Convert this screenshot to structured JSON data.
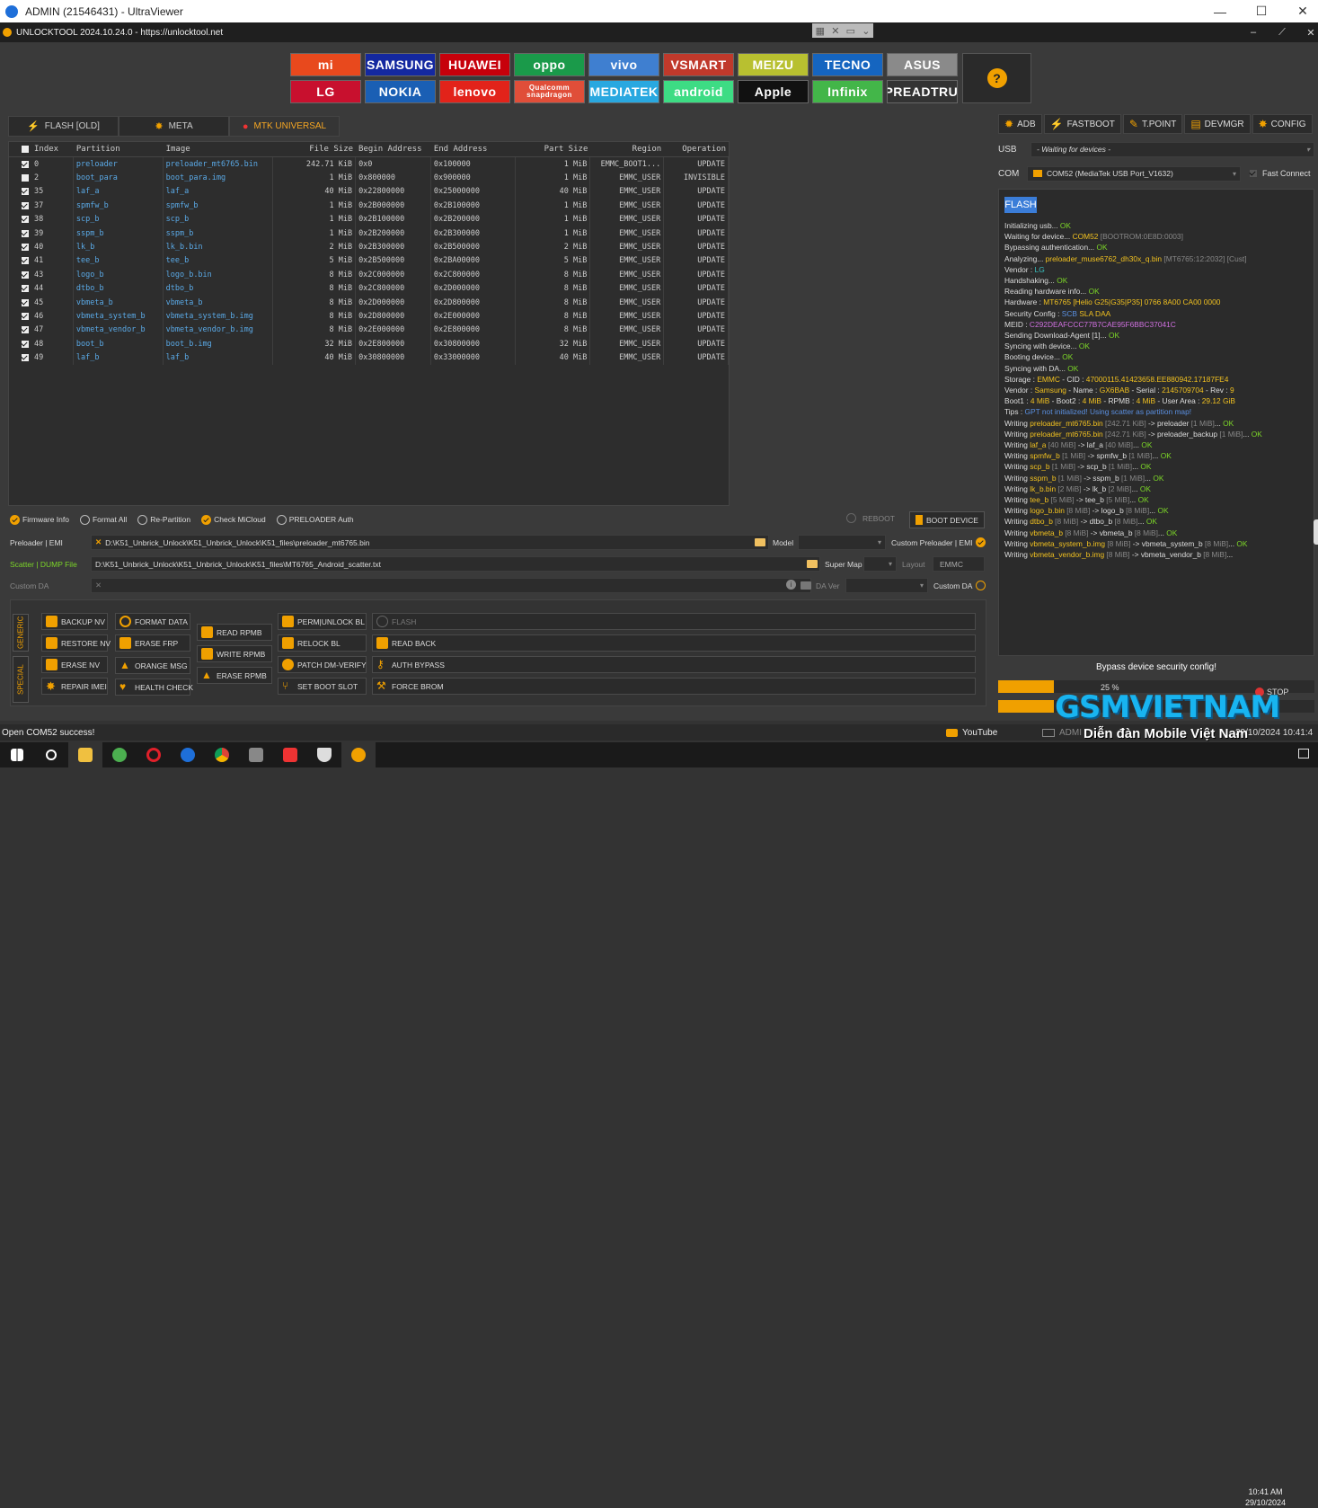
{
  "uv": {
    "title": "ADMIN (21546431) - UltraViewer"
  },
  "app": {
    "title": "UNLOCKTOOL 2024.10.24.0 - https://unlocktool.net"
  },
  "brands": [
    {
      "name": "mi",
      "bg": "#e8491d"
    },
    {
      "name": "SAMSUNG",
      "bg": "#1428a0"
    },
    {
      "name": "HUAWEI",
      "bg": "#c7000b"
    },
    {
      "name": "oppo",
      "bg": "#1a9a4a"
    },
    {
      "name": "vivo",
      "bg": "#3f7fd0"
    },
    {
      "name": "VSMART",
      "bg": "#c0392b"
    },
    {
      "name": "MEIZU",
      "bg": "#b8c030"
    },
    {
      "name": "TECNO",
      "bg": "#1565c0"
    },
    {
      "name": "ASUS",
      "bg": "#8a8a8a"
    },
    {
      "name": "LG",
      "bg": "#c8102e"
    },
    {
      "name": "NOKIA",
      "bg": "#1a5fb4"
    },
    {
      "name": "lenovo",
      "bg": "#e2231a"
    },
    {
      "name": "Qualcomm snapdragon",
      "bg": "#e04e39"
    },
    {
      "name": "MEDIATEK",
      "bg": "#29a8e0"
    },
    {
      "name": "android",
      "bg": "#3ddc84"
    },
    {
      "name": "Apple",
      "bg": "#111111"
    },
    {
      "name": "Infinix",
      "bg": "#43b649"
    },
    {
      "name": "SPREADTRUM",
      "bg": "#333333"
    }
  ],
  "help": {
    "icon": "question-icon",
    "glyph": "?"
  },
  "tabs": [
    {
      "label": "FLASH [OLD]",
      "glyph": "⚡"
    },
    {
      "label": "META",
      "glyph": "✸"
    },
    {
      "label": "MTK UNIVERSAL",
      "glyph": "●"
    }
  ],
  "grid": {
    "headers": [
      "Index",
      "Partition",
      "Image",
      "File Size",
      "Begin Address",
      "End Address",
      "Part Size",
      "Region",
      "Operation"
    ],
    "rows": [
      {
        "idx": "0",
        "part": "preloader",
        "img": "preloader_mt6765.bin",
        "fs": "242.71 KiB",
        "ba": "0x0",
        "ea": "0x100000",
        "ps": "1 MiB",
        "reg": "EMMC_BOOT1...",
        "op": "UPDATE",
        "checked": true
      },
      {
        "idx": "2",
        "part": "boot_para",
        "img": "boot_para.img",
        "fs": "1 MiB",
        "ba": "0x800000",
        "ea": "0x900000",
        "ps": "1 MiB",
        "reg": "EMMC_USER",
        "op": "INVISIBLE",
        "checked": false
      },
      {
        "idx": "35",
        "part": "laf_a",
        "img": "laf_a",
        "fs": "40 MiB",
        "ba": "0x22800000",
        "ea": "0x25000000",
        "ps": "40 MiB",
        "reg": "EMMC_USER",
        "op": "UPDATE",
        "checked": true
      },
      {
        "idx": "37",
        "part": "spmfw_b",
        "img": "spmfw_b",
        "fs": "1 MiB",
        "ba": "0x2B000000",
        "ea": "0x2B100000",
        "ps": "1 MiB",
        "reg": "EMMC_USER",
        "op": "UPDATE",
        "checked": true
      },
      {
        "idx": "38",
        "part": "scp_b",
        "img": "scp_b",
        "fs": "1 MiB",
        "ba": "0x2B100000",
        "ea": "0x2B200000",
        "ps": "1 MiB",
        "reg": "EMMC_USER",
        "op": "UPDATE",
        "checked": true
      },
      {
        "idx": "39",
        "part": "sspm_b",
        "img": "sspm_b",
        "fs": "1 MiB",
        "ba": "0x2B200000",
        "ea": "0x2B300000",
        "ps": "1 MiB",
        "reg": "EMMC_USER",
        "op": "UPDATE",
        "checked": true
      },
      {
        "idx": "40",
        "part": "lk_b",
        "img": "lk_b.bin",
        "fs": "2 MiB",
        "ba": "0x2B300000",
        "ea": "0x2B500000",
        "ps": "2 MiB",
        "reg": "EMMC_USER",
        "op": "UPDATE",
        "checked": true
      },
      {
        "idx": "41",
        "part": "tee_b",
        "img": "tee_b",
        "fs": "5 MiB",
        "ba": "0x2B500000",
        "ea": "0x2BA00000",
        "ps": "5 MiB",
        "reg": "EMMC_USER",
        "op": "UPDATE",
        "checked": true
      },
      {
        "idx": "43",
        "part": "logo_b",
        "img": "logo_b.bin",
        "fs": "8 MiB",
        "ba": "0x2C000000",
        "ea": "0x2C800000",
        "ps": "8 MiB",
        "reg": "EMMC_USER",
        "op": "UPDATE",
        "checked": true
      },
      {
        "idx": "44",
        "part": "dtbo_b",
        "img": "dtbo_b",
        "fs": "8 MiB",
        "ba": "0x2C800000",
        "ea": "0x2D000000",
        "ps": "8 MiB",
        "reg": "EMMC_USER",
        "op": "UPDATE",
        "checked": true
      },
      {
        "idx": "45",
        "part": "vbmeta_b",
        "img": "vbmeta_b",
        "fs": "8 MiB",
        "ba": "0x2D000000",
        "ea": "0x2D800000",
        "ps": "8 MiB",
        "reg": "EMMC_USER",
        "op": "UPDATE",
        "checked": true
      },
      {
        "idx": "46",
        "part": "vbmeta_system_b",
        "img": "vbmeta_system_b.img",
        "fs": "8 MiB",
        "ba": "0x2D800000",
        "ea": "0x2E000000",
        "ps": "8 MiB",
        "reg": "EMMC_USER",
        "op": "UPDATE",
        "checked": true
      },
      {
        "idx": "47",
        "part": "vbmeta_vendor_b",
        "img": "vbmeta_vendor_b.img",
        "fs": "8 MiB",
        "ba": "0x2E000000",
        "ea": "0x2E800000",
        "ps": "8 MiB",
        "reg": "EMMC_USER",
        "op": "UPDATE",
        "checked": true
      },
      {
        "idx": "48",
        "part": "boot_b",
        "img": "boot_b.img",
        "fs": "32 MiB",
        "ba": "0x2E800000",
        "ea": "0x30800000",
        "ps": "32 MiB",
        "reg": "EMMC_USER",
        "op": "UPDATE",
        "checked": true
      },
      {
        "idx": "49",
        "part": "laf_b",
        "img": "laf_b",
        "fs": "40 MiB",
        "ba": "0x30800000",
        "ea": "0x33000000",
        "ps": "40 MiB",
        "reg": "EMMC_USER",
        "op": "UPDATE",
        "checked": true
      }
    ]
  },
  "options": [
    {
      "label": "Firmware Info",
      "checked": true
    },
    {
      "label": "Format All",
      "checked": false
    },
    {
      "label": "Re-Partition",
      "checked": false
    },
    {
      "label": "Check MiCloud",
      "checked": true
    },
    {
      "label": "PRELOADER Auth",
      "checked": false
    }
  ],
  "reboot": "REBOOT",
  "boot_device": "BOOT DEVICE",
  "preloader": {
    "label": "Preloader | EMI",
    "path": "D:\\K51_Unbrick_Unlock\\K51_Unbrick_Unlock\\K51_files\\preloader_mt6765.bin"
  },
  "model_label": "Model",
  "custom_preloader": "Custom Preloader | EMI",
  "scatter": {
    "label": "Scatter | DUMP File",
    "path": "D:\\K51_Unbrick_Unlock\\K51_Unbrick_Unlock\\K51_files\\MT6765_Android_scatter.txt"
  },
  "super_map": "Super Map",
  "layout_label": "Layout",
  "layout_value": "EMMC",
  "custom_da": {
    "label": "Custom DA",
    "right": "Custom DA",
    "da_ver": "DA Ver"
  },
  "vtabs": {
    "generic": "GENERIC",
    "special": "SPECIAL"
  },
  "buttons": {
    "backup_nv": "BACKUP NV",
    "restore_nv": "RESTORE NV",
    "erase_nv": "ERASE NV",
    "repair_imei": "REPAIR IMEI",
    "format_data": "FORMAT DATA",
    "erase_frp": "ERASE FRP",
    "orange_msg": "ORANGE MSG",
    "health_check": "HEALTH CHECK",
    "read_rpmb": "READ RPMB",
    "write_rpmb": "WRITE RPMB",
    "erase_rpmb": "ERASE RPMB",
    "perm_unlock": "PERM|UNLOCK BL",
    "relock": "RELOCK BL",
    "patch_dm": "PATCH DM-VERIFY",
    "set_boot": "SET BOOT SLOT",
    "flash": "FLASH",
    "read_back": "READ BACK",
    "auth_bypass": "AUTH BYPASS",
    "force_brom": "FORCE BROM"
  },
  "rtabs": [
    {
      "label": "ADB",
      "glyph": "✹"
    },
    {
      "label": "FASTBOOT",
      "glyph": "⚡"
    },
    {
      "label": "T.POINT",
      "glyph": "✎"
    },
    {
      "label": "DEVMGR",
      "glyph": "▤"
    },
    {
      "label": "CONFIG",
      "glyph": "✸"
    }
  ],
  "usb": {
    "label": "USB",
    "value": "- Waiting for devices -"
  },
  "com": {
    "label": "COM",
    "value": "COM52 (MediaTek USB Port_V1632)",
    "fast_connect": "Fast Connect"
  },
  "flash_badge": "FLASH",
  "log": [
    [
      [
        "Initializing usb... ",
        ""
      ],
      [
        "OK",
        "ok"
      ]
    ],
    [
      [
        "Waiting for device... ",
        ""
      ],
      [
        "COM52",
        "y"
      ],
      [
        " [BOOTROM:0E8D:0003]",
        "g"
      ]
    ],
    [
      [
        "Bypassing authentication... ",
        ""
      ],
      [
        "OK",
        "ok"
      ]
    ],
    [
      [
        "Analyzing... ",
        ""
      ],
      [
        "preloader_muse6762_dh30x_q.bin",
        "y"
      ],
      [
        " [MT6765:12:2032] [Cust]",
        "g"
      ]
    ],
    [
      [
        "Vendor : ",
        ""
      ],
      [
        "LG",
        "cy"
      ]
    ],
    [
      [
        "Handshaking... ",
        ""
      ],
      [
        "OK",
        "ok"
      ]
    ],
    [
      [
        "Reading hardware info... ",
        ""
      ],
      [
        "OK",
        "ok"
      ]
    ],
    [
      [
        "  Hardware : ",
        ""
      ],
      [
        "MT6765 [Helio G25|G35|P35] 0766 8A00 CA00 0000",
        "y"
      ]
    ],
    [
      [
        "  Security Config : ",
        ""
      ],
      [
        "SCB ",
        "bl"
      ],
      [
        "SLA DAA",
        "y"
      ]
    ],
    [
      [
        "  MEID : ",
        ""
      ],
      [
        "C292DEAFCCC77B7CAE95F6BBC37041C",
        "pk"
      ]
    ],
    [
      [
        "Sending Download-Agent [1]... ",
        ""
      ],
      [
        "OK",
        "ok"
      ]
    ],
    [
      [
        "Syncing with device... ",
        ""
      ],
      [
        "OK",
        "ok"
      ]
    ],
    [
      [
        "Booting device... ",
        ""
      ],
      [
        "OK",
        "ok"
      ]
    ],
    [
      [
        "Syncing with DA... ",
        ""
      ],
      [
        "OK",
        "ok"
      ]
    ],
    [
      [
        "  Storage : ",
        ""
      ],
      [
        "EMMC",
        "y"
      ],
      [
        " - CID : ",
        ""
      ],
      [
        "47000115.41423658.EE880942.17187FE4",
        "y"
      ]
    ],
    [
      [
        "  Vendor : ",
        ""
      ],
      [
        "Samsung",
        "y"
      ],
      [
        " - Name : ",
        ""
      ],
      [
        "GX6BAB",
        "y"
      ],
      [
        " - Serial : ",
        ""
      ],
      [
        "2145709704",
        "y"
      ],
      [
        " - Rev : ",
        ""
      ],
      [
        "9",
        "y"
      ]
    ],
    [
      [
        "  Boot1 : ",
        ""
      ],
      [
        "4 MiB",
        "y"
      ],
      [
        " - Boot2 : ",
        ""
      ],
      [
        "4 MiB",
        "y"
      ],
      [
        " - RPMB : ",
        ""
      ],
      [
        "4 MiB",
        "y"
      ],
      [
        " - User Area : ",
        ""
      ],
      [
        "29.12 GiB",
        "y"
      ]
    ],
    [
      [
        "Tips : ",
        ""
      ],
      [
        "GPT not initialized! Using scatter as partition map!",
        "lg"
      ]
    ],
    [
      [
        "Writing ",
        ""
      ],
      [
        "preloader_mt6765.bin",
        "y"
      ],
      [
        " [242.71 KiB]",
        "g"
      ],
      [
        " -> preloader ",
        ""
      ],
      [
        "[1 MiB]",
        "g"
      ],
      [
        "... ",
        ""
      ],
      [
        "OK",
        "ok"
      ]
    ],
    [
      [
        "Writing ",
        ""
      ],
      [
        "preloader_mt6765.bin",
        "y"
      ],
      [
        " [242.71 KiB]",
        "g"
      ],
      [
        " -> preloader_backup ",
        ""
      ],
      [
        "[1 MiB]",
        "g"
      ],
      [
        "... ",
        ""
      ],
      [
        "OK",
        "ok"
      ]
    ],
    [
      [
        "Writing ",
        ""
      ],
      [
        "laf_a",
        "y"
      ],
      [
        " [40 MiB]",
        "g"
      ],
      [
        " -> laf_a ",
        ""
      ],
      [
        "[40 MiB]",
        "g"
      ],
      [
        "... ",
        ""
      ],
      [
        "OK",
        "ok"
      ]
    ],
    [
      [
        "Writing ",
        ""
      ],
      [
        "spmfw_b",
        "y"
      ],
      [
        " [1 MiB]",
        "g"
      ],
      [
        " -> spmfw_b ",
        ""
      ],
      [
        "[1 MiB]",
        "g"
      ],
      [
        "... ",
        ""
      ],
      [
        "OK",
        "ok"
      ]
    ],
    [
      [
        "Writing ",
        ""
      ],
      [
        "scp_b",
        "y"
      ],
      [
        " [1 MiB]",
        "g"
      ],
      [
        " -> scp_b ",
        ""
      ],
      [
        "[1 MiB]",
        "g"
      ],
      [
        "... ",
        ""
      ],
      [
        "OK",
        "ok"
      ]
    ],
    [
      [
        "Writing ",
        ""
      ],
      [
        "sspm_b",
        "y"
      ],
      [
        " [1 MiB]",
        "g"
      ],
      [
        " -> sspm_b ",
        ""
      ],
      [
        "[1 MiB]",
        "g"
      ],
      [
        "... ",
        ""
      ],
      [
        "OK",
        "ok"
      ]
    ],
    [
      [
        "Writing ",
        ""
      ],
      [
        "lk_b.bin",
        "y"
      ],
      [
        " [2 MiB]",
        "g"
      ],
      [
        " -> lk_b ",
        ""
      ],
      [
        "[2 MiB]",
        "g"
      ],
      [
        "... ",
        ""
      ],
      [
        "OK",
        "ok"
      ]
    ],
    [
      [
        "Writing ",
        ""
      ],
      [
        "tee_b",
        "y"
      ],
      [
        " [5 MiB]",
        "g"
      ],
      [
        " -> tee_b ",
        ""
      ],
      [
        "[5 MiB]",
        "g"
      ],
      [
        "... ",
        ""
      ],
      [
        "OK",
        "ok"
      ]
    ],
    [
      [
        "Writing ",
        ""
      ],
      [
        "logo_b.bin",
        "y"
      ],
      [
        " [8 MiB]",
        "g"
      ],
      [
        " -> logo_b ",
        ""
      ],
      [
        "[8 MiB]",
        "g"
      ],
      [
        "... ",
        ""
      ],
      [
        "OK",
        "ok"
      ]
    ],
    [
      [
        "Writing ",
        ""
      ],
      [
        "dtbo_b",
        "y"
      ],
      [
        " [8 MiB]",
        "g"
      ],
      [
        " -> dtbo_b ",
        ""
      ],
      [
        "[8 MiB]",
        "g"
      ],
      [
        "... ",
        ""
      ],
      [
        "OK",
        "ok"
      ]
    ],
    [
      [
        "Writing ",
        ""
      ],
      [
        "vbmeta_b",
        "y"
      ],
      [
        " [8 MiB]",
        "g"
      ],
      [
        " -> vbmeta_b ",
        ""
      ],
      [
        "[8 MiB]",
        "g"
      ],
      [
        "... ",
        ""
      ],
      [
        "OK",
        "ok"
      ]
    ],
    [
      [
        "Writing ",
        ""
      ],
      [
        "vbmeta_system_b.img",
        "y"
      ],
      [
        " [8 MiB]",
        "g"
      ],
      [
        " -> vbmeta_system_b ",
        ""
      ],
      [
        "[8 MiB]",
        "g"
      ],
      [
        "... ",
        ""
      ],
      [
        "OK",
        "ok"
      ]
    ],
    [
      [
        "Writing ",
        ""
      ],
      [
        "vbmeta_vendor_b.img",
        "y"
      ],
      [
        " [8 MiB]",
        "g"
      ],
      [
        " -> vbmeta_vendor_b ",
        ""
      ],
      [
        "[8 MiB]",
        "g"
      ],
      [
        "...",
        ""
      ]
    ]
  ],
  "bypass": "Bypass device security config!",
  "progress": {
    "percent": 25,
    "label": "25 %"
  },
  "stop": "STOP",
  "status": {
    "text": "Open COM52 success!",
    "youtube": "YouTube",
    "admin": "ADMI",
    "date": "29/10/2024 10:41:4"
  },
  "watermark": {
    "brand": "GSMVIETNAM",
    "tagline": "Diễn đàn Mobile Việt Nam"
  },
  "clock": {
    "time": "10:41 AM",
    "date": "29/10/2024"
  },
  "colors": {
    "accent": "#f0a000",
    "log_ok": "#7cd628",
    "log_value": "#f0c020"
  }
}
